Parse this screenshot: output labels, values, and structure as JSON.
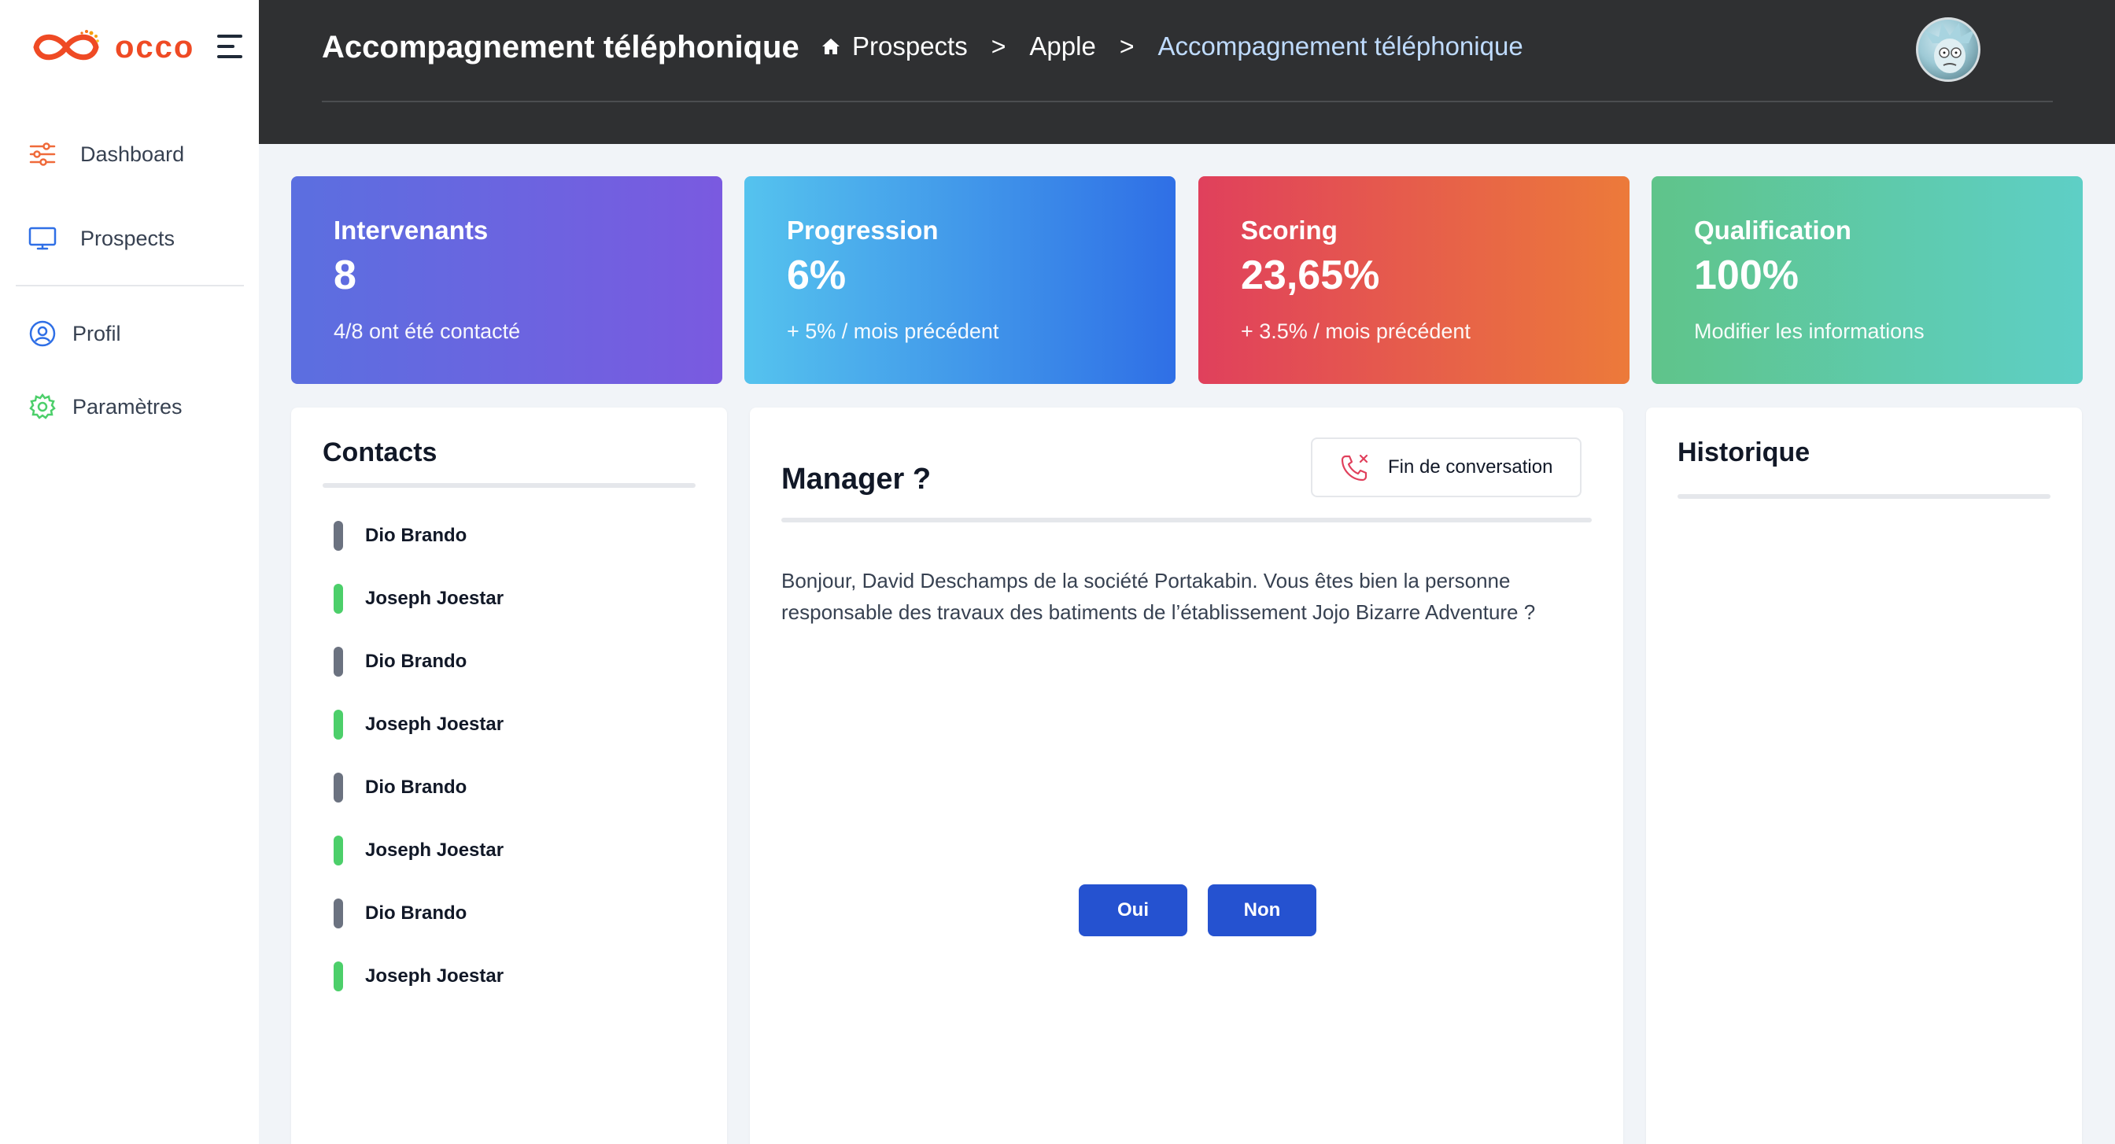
{
  "brand": {
    "name": "occo",
    "accent": "#ef4a24"
  },
  "sidebar": {
    "items": [
      {
        "label": "Dashboard",
        "icon": "sliders-icon"
      },
      {
        "label": "Prospects",
        "icon": "monitor-icon"
      },
      {
        "label": "Profil",
        "icon": "user-circle-icon"
      },
      {
        "label": "Paramètres",
        "icon": "gear-icon"
      }
    ]
  },
  "header": {
    "title": "Accompagnement téléphonique",
    "breadcrumb": [
      {
        "label": "Prospects",
        "icon": "home-icon"
      },
      {
        "label": "Apple"
      },
      {
        "label": "Accompagnement téléphonique"
      }
    ],
    "separator": ">"
  },
  "stats": [
    {
      "title": "Intervenants",
      "value": "8",
      "sub": "4/8 ont été contacté"
    },
    {
      "title": "Progression",
      "value": "6%",
      "sub": "+ 5% / mois précédent"
    },
    {
      "title": "Scoring",
      "value": "23,65%",
      "sub": "+ 3.5% / mois précédent"
    },
    {
      "title": "Qualification",
      "value": "100%",
      "sub": "Modifier les informations"
    }
  ],
  "contacts": {
    "title": "Contacts",
    "items": [
      {
        "name": "Dio Brando",
        "status": "grey"
      },
      {
        "name": "Joseph Joestar",
        "status": "green"
      },
      {
        "name": "Dio Brando",
        "status": "grey"
      },
      {
        "name": "Joseph Joestar",
        "status": "green"
      },
      {
        "name": "Dio Brando",
        "status": "grey"
      },
      {
        "name": "Joseph Joestar",
        "status": "green"
      },
      {
        "name": "Dio Brando",
        "status": "grey"
      },
      {
        "name": "Joseph Joestar",
        "status": "green"
      }
    ]
  },
  "script": {
    "title": "Manager ?",
    "end_call_label": "Fin de conversation",
    "question": "Bonjour, David Deschamps de la société Portakabin. Vous êtes bien la personne responsable des travaux des batiments de l’établissement Jojo Bizarre Adventure ?",
    "yes_label": "Oui",
    "no_label": "Non"
  },
  "history": {
    "title": "Historique"
  },
  "colors": {
    "header_bg": "#2f3032",
    "button_primary": "#2552d0",
    "status_green": "#4ccf6a",
    "status_grey": "#6b7280"
  }
}
